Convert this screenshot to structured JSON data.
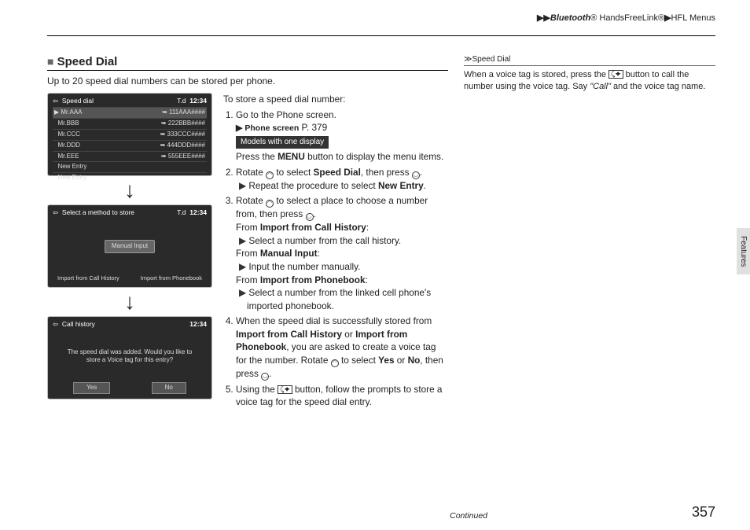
{
  "breadcrumb": {
    "a": "Bluetooth",
    "reg": "®",
    "b": "HandsFreeLink®",
    "c": "HFL Menus"
  },
  "section": {
    "title": "Speed Dial",
    "intro": "Up to 20 speed dial numbers can be stored per phone."
  },
  "screens": {
    "s1": {
      "title": "Speed dial",
      "bt": "T.d",
      "clock": "12:34",
      "rows": [
        {
          "n": "Mr.AAA",
          "p": "111AAA####"
        },
        {
          "n": "Mr.BBB",
          "p": "222BBB####"
        },
        {
          "n": "Mr.CCC",
          "p": "333CCC####"
        },
        {
          "n": "Mr.DDD",
          "p": "444DDD####"
        },
        {
          "n": "Mr.EEE",
          "p": "555EEE####"
        }
      ],
      "new1": "New Entry",
      "new2": "New Entry"
    },
    "s2": {
      "title": "Select a method to store",
      "bt": "T.d",
      "clock": "12:34",
      "mid": "Manual Input",
      "optL": "Import from Call History",
      "optR": "Import from Phonebook"
    },
    "s3": {
      "title": "Call history",
      "clock": "12:34",
      "msg": "The speed dial was added. Would you like to store a Voice tag for this entry?",
      "yes": "Yes",
      "no": "No"
    }
  },
  "steps": {
    "lead": "To store a speed dial number:",
    "s1a": "Go to the Phone screen.",
    "s1ref_label": "Phone screen",
    "s1ref_page": "P. 379",
    "badge": "Models with one display",
    "s1b_pre": "Press the ",
    "s1b_bold": "MENU",
    "s1b_post": " button to display the menu items.",
    "s2_pre": "Rotate ",
    "s2_mid": " to select ",
    "s2_bold": "Speed Dial",
    "s2_post": ", then press ",
    "s2b_pre": "Repeat the procedure to select ",
    "s2b_bold": "New Entry",
    "s2b_post": ".",
    "s3_pre": "Rotate ",
    "s3_mid": " to select a place to choose a number from, then press ",
    "s3a_lbl_pre": "From ",
    "s3a_lbl": "Import from Call History",
    "s3a_txt": "Select a number from the call history.",
    "s3b_lbl": "Manual Input",
    "s3b_txt": "Input the number manually.",
    "s3c_lbl": "Import from Phonebook",
    "s3c_txt": "Select a number from the linked cell phone's imported phonebook.",
    "s4_pre": "When the speed dial is successfully stored from ",
    "s4_b1": "Import from Call History",
    "s4_or": " or ",
    "s4_b2": "Import from Phonebook",
    "s4_mid": ", you are asked to create a voice tag for the number. Rotate ",
    "s4_sel": " to select ",
    "s4_yes": "Yes",
    "s4_or2": " or ",
    "s4_no": "No",
    "s4_post": ", then press ",
    "s5_pre": "Using the ",
    "s5_post": " button, follow the prompts to store a voice tag for the speed dial entry."
  },
  "sidebar": {
    "title": "Speed Dial",
    "l1a": "When a voice tag is stored, press the ",
    "l1b": " button to call the number using the voice tag. Say ",
    "call": "\"Call\"",
    "l1c": " and the voice tag name."
  },
  "footer": {
    "cont": "Continued",
    "page": "357",
    "tab": "Features"
  }
}
